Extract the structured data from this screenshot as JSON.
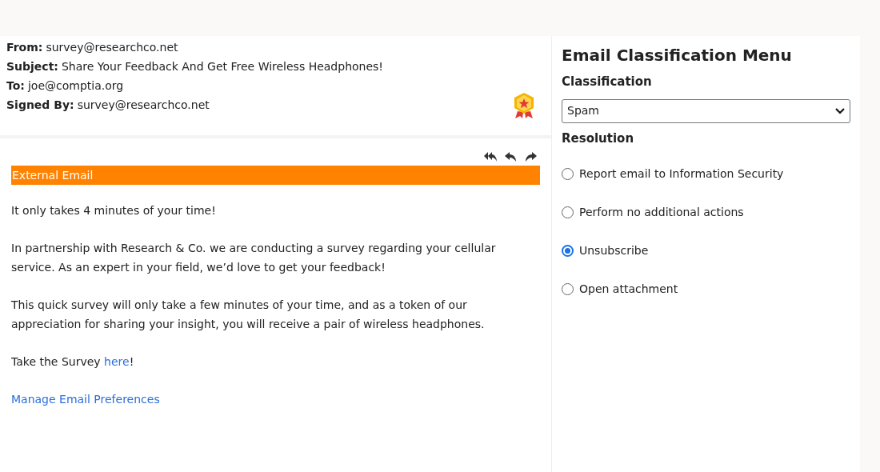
{
  "email": {
    "headers": [
      {
        "label": "From:",
        "value": "survey@researchco.net"
      },
      {
        "label": "Subject:",
        "value": "Share Your Feedback And Get Free Wireless Headphones!"
      },
      {
        "label": "To:",
        "value": "joe@comptia.org"
      },
      {
        "label": "Signed By:",
        "value": "survey@researchco.net"
      }
    ],
    "banner": "External Email",
    "paragraphs": [
      "It only takes 4 minutes of your time!",
      "In partnership with Research & Co. we are conducting a survey regarding your cellular service. As an expert in your field, we’d love to get your feedback!",
      "This quick survey will only take a few minutes of your time, and as a token of our appreciation for sharing your insight, you will receive a pair of wireless headphones."
    ],
    "survey_line": {
      "before": "Take the Survey ",
      "link": "here",
      "after": "!"
    },
    "preferences_link": "Manage Email Preferences"
  },
  "menu": {
    "title": "Email Classification Menu",
    "classification_label": "Classification",
    "classification_value": "Spam",
    "resolution_label": "Resolution",
    "options": [
      {
        "label": "Report email to Information Security",
        "selected": false
      },
      {
        "label": "Perform no additional actions",
        "selected": false
      },
      {
        "label": "Unsubscribe",
        "selected": true
      },
      {
        "label": "Open attachment",
        "selected": false
      }
    ]
  }
}
